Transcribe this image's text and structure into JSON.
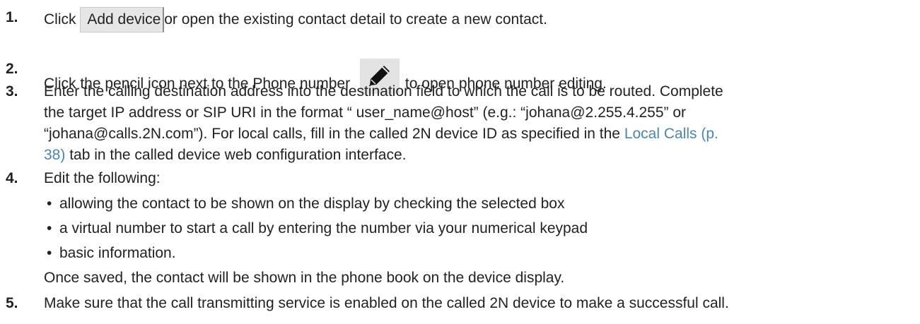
{
  "steps": [
    {
      "number": "1.",
      "button_label": "Add device",
      "text": "or open the existing contact detail to create a new contact."
    },
    {
      "number": "2.",
      "text_before": "Click the pencil icon next to the Phone number",
      "icon": "pencil-icon",
      "text_after": "to open phone number editing."
    },
    {
      "number": "3.",
      "line1": "Enter the calling destination address into the destination field to which the call is to be routed. Complete",
      "line2": "the target IP address or SIP URI in the format “ user_name@host” (e.g.: “johana@2.255.4.255” or",
      "line3_before": "“johana@calls.2N.com”). For local calls, fill in the called 2N device ID as specified in the ",
      "link_part1": "Local Calls (p.",
      "link_part2": "38)",
      "line4_after": " tab in the called device web configuration interface."
    },
    {
      "number": "4.",
      "text": "Edit the following:",
      "bullets": [
        "allowing the contact to be shown on the display by checking the selected box",
        "a virtual number to start a call by entering the number via your numerical keypad",
        "basic information."
      ],
      "after": "Once saved, the contact will be shown in the phone book on the device display."
    },
    {
      "number": "5.",
      "text": "Make sure that the call transmitting service is enabled on the called 2N device to make a successful call."
    }
  ],
  "labels": {
    "click": "Click",
    "bullet_char": "•"
  },
  "colors": {
    "text": "#222222",
    "link": "#4a86b5",
    "button_bg": "#e6e6e6"
  }
}
